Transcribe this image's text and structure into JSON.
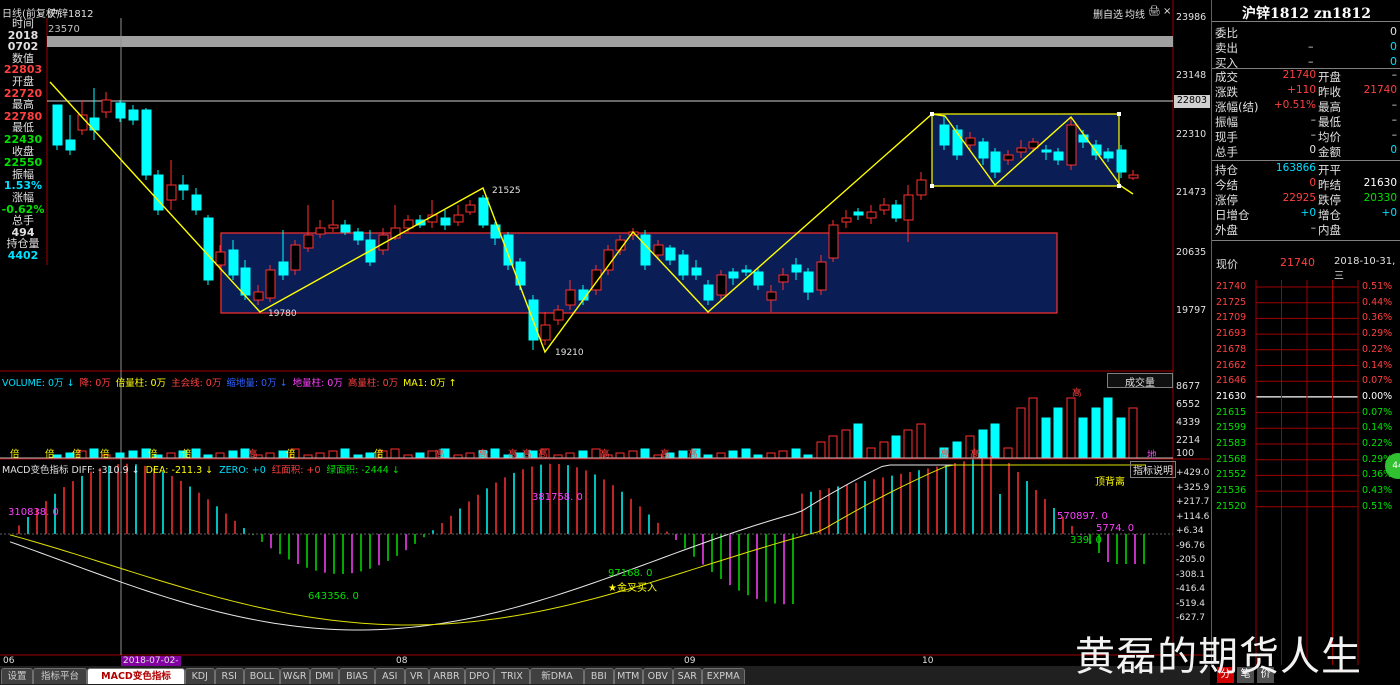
{
  "window": {
    "title_left": "日线(前复权)",
    "symbol_tab": "沪锌1812",
    "top_buttons": [
      "删自选",
      "均线",
      "🖨",
      "×"
    ]
  },
  "left_info": [
    {
      "label": "时间",
      "value": "2018",
      "color": "#e0e0e0"
    },
    {
      "label": "",
      "value": "0702",
      "color": "#e0e0e0"
    },
    {
      "label": "数值",
      "value": "22803",
      "color": "#ff4040"
    },
    {
      "label": "开盘",
      "value": "22720",
      "color": "#ff4040"
    },
    {
      "label": "最高",
      "value": "22780",
      "color": "#ff4040"
    },
    {
      "label": "最低",
      "value": "22430",
      "color": "#00e000"
    },
    {
      "label": "收盘",
      "value": "22550",
      "color": "#00e000"
    },
    {
      "label": "振幅",
      "value": "1.53%",
      "color": "#00e0ff"
    },
    {
      "label": "涨幅",
      "value": "-0.62%",
      "color": "#00e000"
    },
    {
      "label": "总手",
      "value": "494",
      "color": "#e0e0e0"
    },
    {
      "label": "持仓量",
      "value": "4402",
      "color": "#00e0ff"
    }
  ],
  "main_chart": {
    "type": "candlestick",
    "top_label": "23570",
    "y_axis": {
      "min": 19260,
      "max": 23986,
      "ticks": [
        "23986",
        "23148",
        "22310",
        "21473",
        "20635",
        "19797"
      ]
    },
    "current_line_label": "22803",
    "extremes": [
      {
        "label": "21525"
      },
      {
        "label": "19780"
      },
      {
        "label": "19210"
      }
    ],
    "x_labels": [
      "06",
      "2018-07-02-",
      "08",
      "09",
      "10"
    ]
  },
  "volume": {
    "legend": [
      {
        "text": "VOLUME: 0万 ↓",
        "color": "#00e0ff"
      },
      {
        "text": "降: 0万",
        "color": "#ff4040"
      },
      {
        "text": "倍量柱: 0万",
        "color": "#ffff00"
      },
      {
        "text": "主会线: 0万",
        "color": "#ff4040"
      },
      {
        "text": "缩地量: 0万 ↓",
        "color": "#3060ff"
      },
      {
        "text": "地量柱: 0万",
        "color": "#ff40ff"
      },
      {
        "text": "高量柱: 0万",
        "color": "#ff4040"
      },
      {
        "text": "MA1: 0万 ↑",
        "color": "#ffff00"
      }
    ],
    "button": "成交量",
    "y_ticks": [
      "8677",
      "6552",
      "4339",
      "2214",
      "100"
    ],
    "marks": [
      "倍",
      "倍",
      "倍",
      "倍",
      "倍",
      "倍",
      "高",
      "倍",
      "倍",
      "高",
      "高",
      "高",
      "高",
      "高",
      "高",
      "高",
      "高",
      "高",
      "高",
      "高"
    ],
    "last_mark": "地"
  },
  "macd": {
    "legend": [
      {
        "text": "MACD变色指标 DIFF: -310.9 ↓",
        "color": "#e0e0e0"
      },
      {
        "text": "DEA: -211.3 ↓",
        "color": "#ffff00"
      },
      {
        "text": "ZERO: +0",
        "color": "#00e0ff"
      },
      {
        "text": "红面积: +0",
        "color": "#ff4040"
      },
      {
        "text": "绿面积: -2444 ↓",
        "color": "#00e000"
      }
    ],
    "button": "指标说明",
    "y_ticks": [
      "+429.0",
      "+325.9",
      "+217.7",
      "+114.6",
      "+6.34",
      "-96.76",
      "-205.0",
      "-308.1",
      "-416.4",
      "-519.4",
      "-627.7"
    ],
    "annotations": [
      {
        "text": "310838. 0",
        "color": "#ff40ff"
      },
      {
        "text": "381758. 0",
        "color": "#ff40ff"
      },
      {
        "text": "643356. 0",
        "color": "#00e000"
      },
      {
        "text": "97168. 0",
        "color": "#00e000"
      },
      {
        "text": "★金叉买入",
        "color": "#ffff00"
      },
      {
        "text": "顶背离",
        "color": "#ffff00"
      },
      {
        "text": "570897. 0",
        "color": "#ff40ff"
      },
      {
        "text": "5774. 0",
        "color": "#ff40ff"
      },
      {
        "text": "339. 0",
        "color": "#00e000"
      }
    ]
  },
  "bottom_tabs": [
    "设置",
    "指标平台",
    "MACD变色指标",
    "KDJ",
    "RSI",
    "BOLL",
    "W&R",
    "DMI",
    "BIAS",
    "ASI",
    "VR",
    "ARBR",
    "DPO",
    "TRIX",
    "新DMA",
    "BBI",
    "MTM",
    "OBV",
    "SAR",
    "EXPMA"
  ],
  "right_tabs": [
    "分",
    "笔",
    "价"
  ],
  "quote": {
    "title": "沪锌1812 zn1812",
    "rows1": [
      {
        "l": "委比",
        "v": "0",
        "c": "#e0e0e0"
      },
      {
        "l": "卖出",
        "m": "–",
        "v": "0",
        "c": "#00e0ff"
      },
      {
        "l": "买入",
        "m": "–",
        "v": "0",
        "c": "#00e0ff"
      }
    ],
    "rows2": [
      {
        "l": "成交",
        "m": "21740",
        "mc": "#ff4040",
        "r": "开盘",
        "v": "–",
        "c": "#e0e0e0"
      },
      {
        "l": "涨跌",
        "m": "+110",
        "mc": "#ff4040",
        "r": "昨收",
        "v": "21740",
        "c": "#ff4040"
      },
      {
        "l": "涨幅(结)",
        "m": "+0.51%",
        "mc": "#ff4040",
        "r": "最高",
        "v": "–",
        "c": "#e0e0e0"
      },
      {
        "l": "振幅",
        "m": "–",
        "mc": "#e0e0e0",
        "r": "最低",
        "v": "–",
        "c": "#e0e0e0"
      },
      {
        "l": "现手",
        "m": "–",
        "mc": "#e0e0e0",
        "r": "均价",
        "v": "–",
        "c": "#e0e0e0"
      },
      {
        "l": "总手",
        "m": "0",
        "mc": "#e0e0e0",
        "r": "金额",
        "v": "0",
        "c": "#00e0ff"
      }
    ],
    "rows3": [
      {
        "l": "持仓",
        "m": "163866",
        "mc": "#00e0ff",
        "r": "开平",
        "v": "",
        "c": "#e0e0e0"
      },
      {
        "l": "今结",
        "m": "0",
        "mc": "#ff4040",
        "r": "昨结",
        "v": "21630",
        "c": "#ffffff"
      },
      {
        "l": "涨停",
        "m": "22925",
        "mc": "#ff4040",
        "r": "跌停",
        "v": "20330",
        "c": "#00e000"
      },
      {
        "l": "日增仓",
        "m": "+0",
        "mc": "#00e0ff",
        "r": "增仓",
        "v": "+0",
        "c": "#00e0ff"
      },
      {
        "l": "外盘",
        "m": "–",
        "mc": "#e0e0e0",
        "r": "内盘",
        "v": "",
        "c": "#e0e0e0"
      }
    ],
    "now": {
      "label": "现价",
      "value": "21740",
      "date": "2018-10-31,三"
    },
    "intraday_left": [
      "21740",
      "21725",
      "21709",
      "21693",
      "21678",
      "21662",
      "21646",
      "21630",
      "21615",
      "21599",
      "21583",
      "21568",
      "21552",
      "21536",
      "21520"
    ],
    "intraday_right": [
      "0.51%",
      "0.44%",
      "0.36%",
      "0.29%",
      "0.22%",
      "0.14%",
      "0.07%",
      "0.00%",
      "0.07%",
      "0.14%",
      "0.22%",
      "0.29%",
      "0.36%",
      "0.43%",
      "0.51%"
    ]
  },
  "watermark": "黄磊的期货人生",
  "colors": {
    "up": "#ff3030",
    "down": "#00ffff",
    "zig": "#ffff00",
    "box_fill": "#0a1e55",
    "box_border": "#ff3030"
  }
}
